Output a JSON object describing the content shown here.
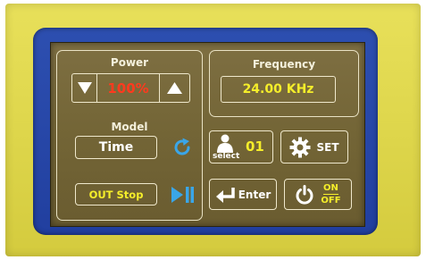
{
  "power": {
    "title": "Power",
    "value": "100%",
    "down_icon": "down-triangle-icon",
    "up_icon": "up-triangle-icon"
  },
  "model": {
    "title": "Model",
    "value": "Time",
    "cycle_icon": "refresh-icon"
  },
  "output": {
    "label": "OUT Stop",
    "icon": "play-pause-icon"
  },
  "frequency": {
    "title": "Frequency",
    "value": "24.00 KHz"
  },
  "select": {
    "label": "select",
    "value": "01",
    "icon": "person-icon"
  },
  "set": {
    "label": "SET",
    "icon": "gear-icon"
  },
  "enter": {
    "label": "Enter",
    "icon": "enter-arrow-icon"
  },
  "power_toggle": {
    "on_label": "ON",
    "off_label": "OFF",
    "icon": "power-icon"
  },
  "colors": {
    "screen": "#736536",
    "frame": "#e9e2c4",
    "red_value": "#ff3a1e",
    "yellow_value": "#f5ee2a",
    "icon_blue": "#3aa6e8",
    "bezel": "#2d4fb0",
    "housing": "#e0d84c"
  }
}
